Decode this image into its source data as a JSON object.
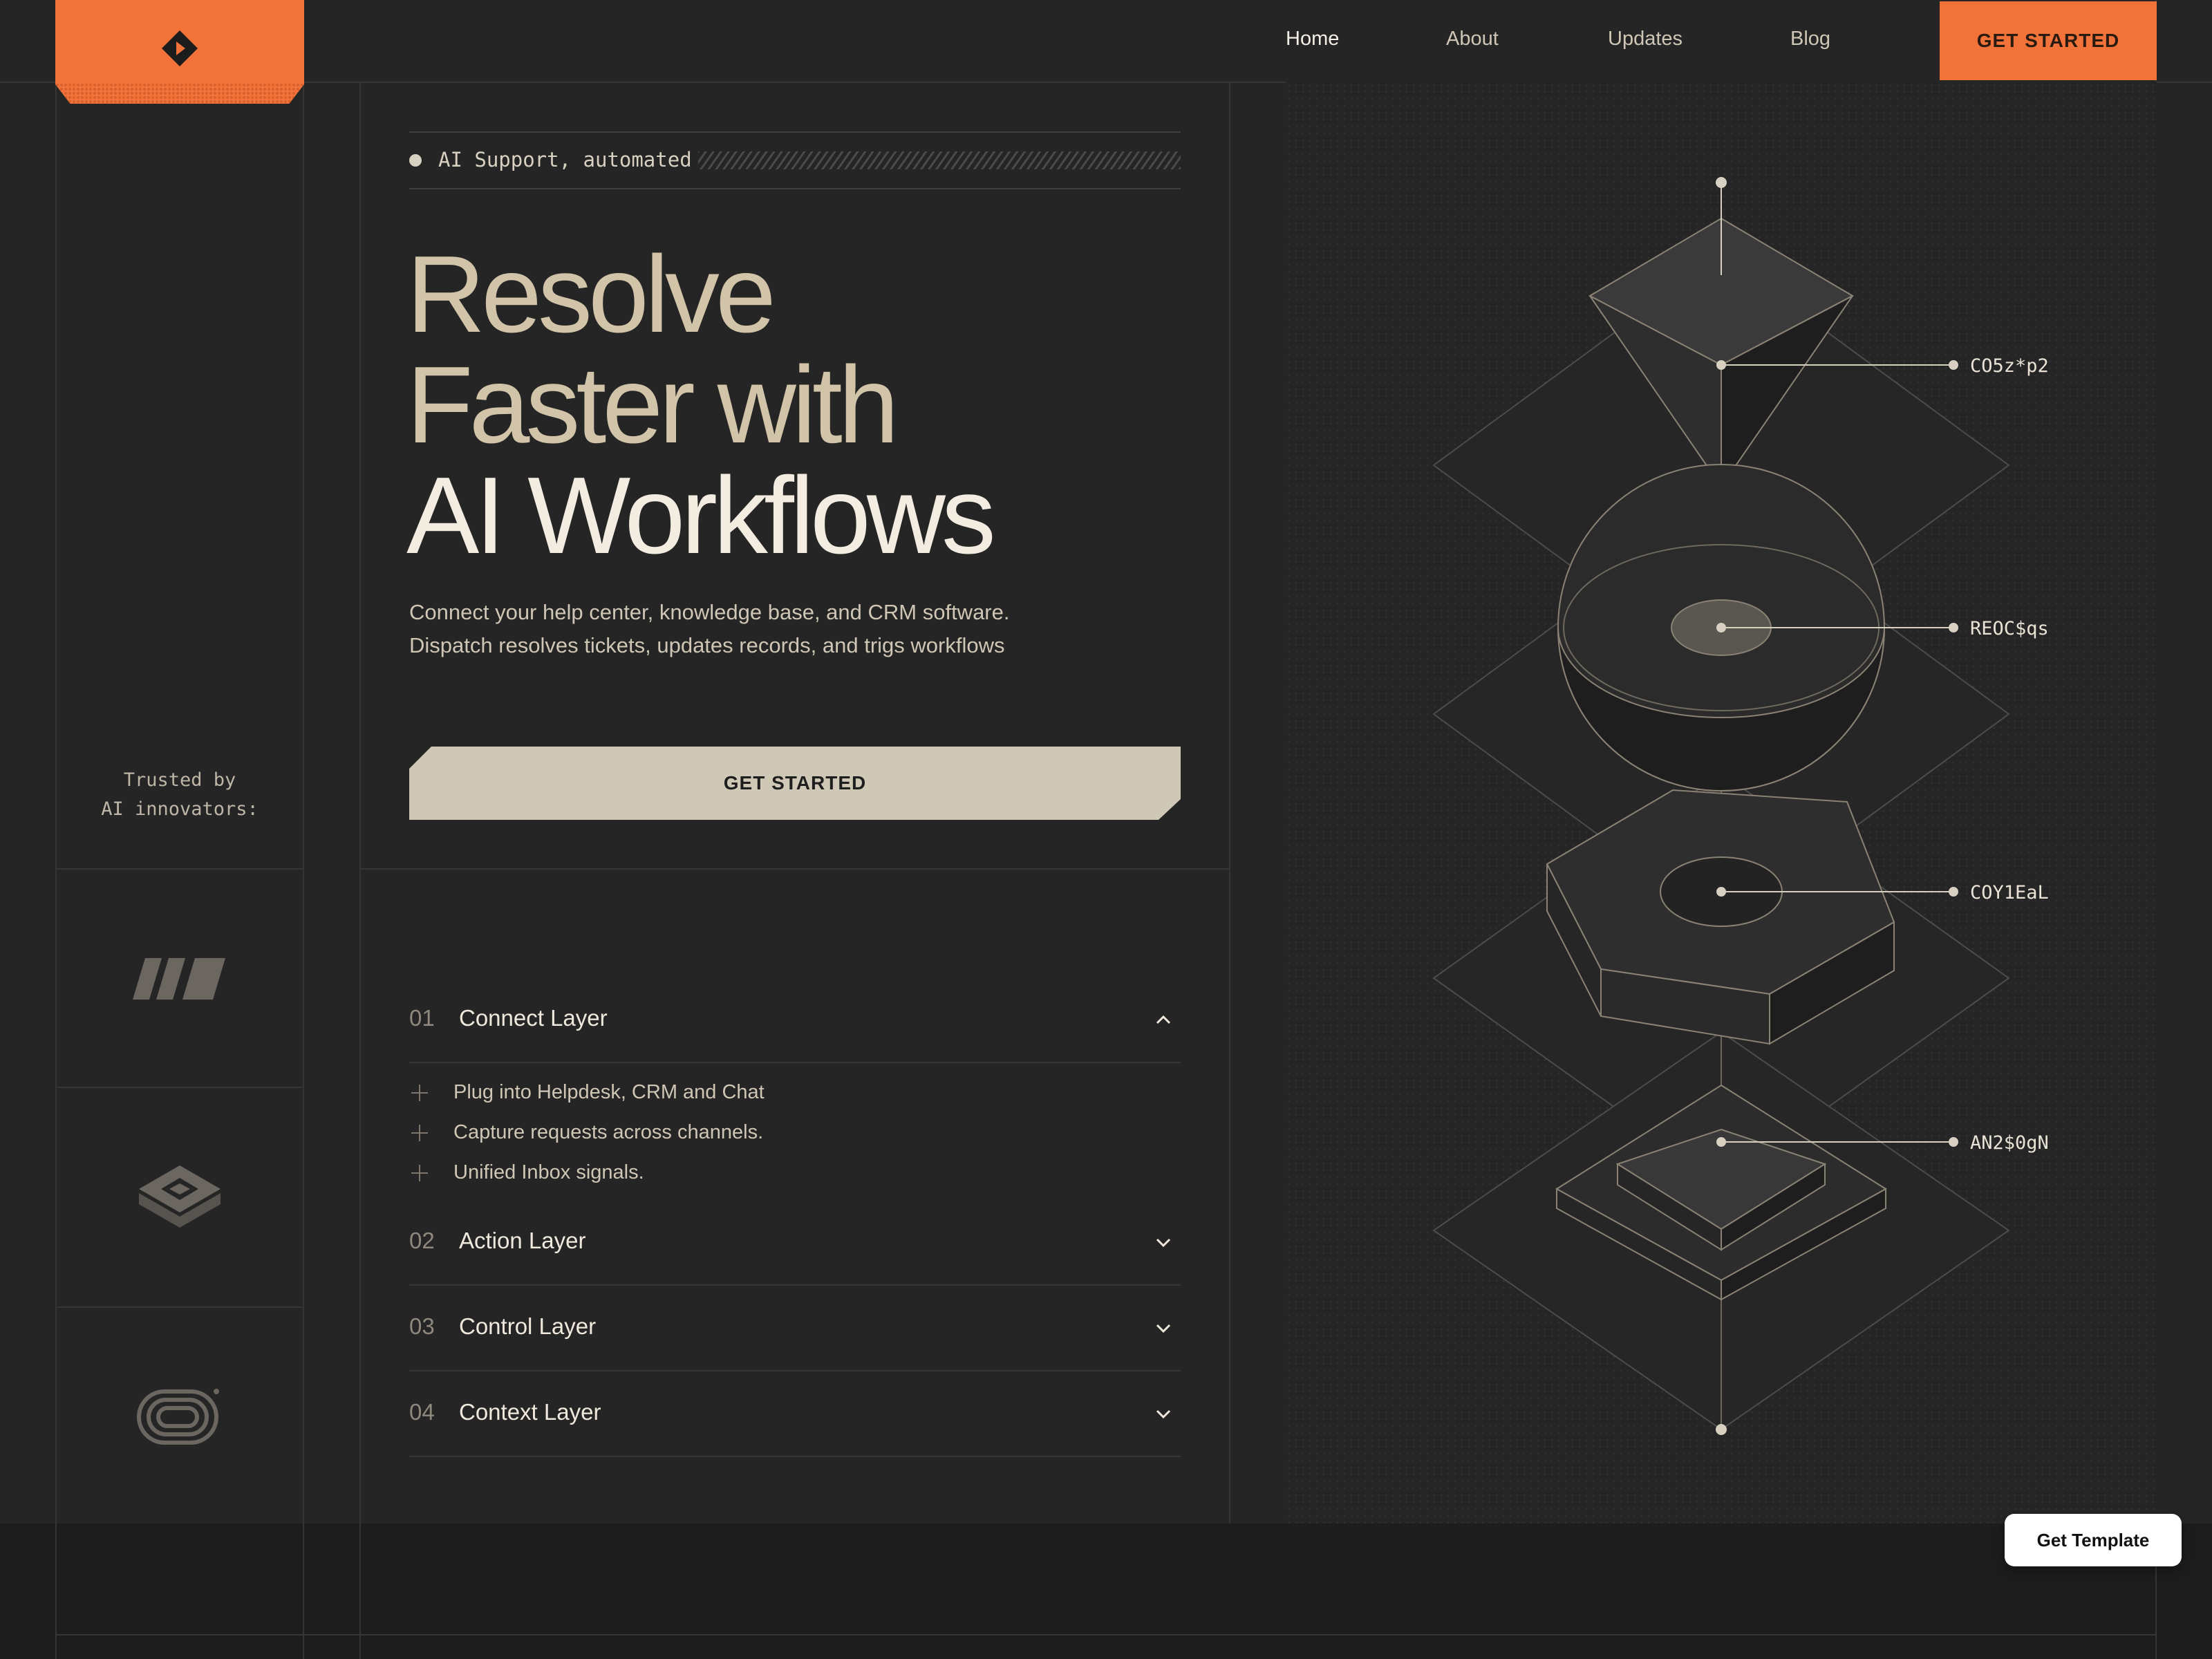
{
  "nav": {
    "links": [
      "Home",
      "About",
      "Updates",
      "Blog"
    ],
    "cta": "GET STARTED"
  },
  "left": {
    "trusted_line1": "Trusted by",
    "trusted_line2": "AI innovators:"
  },
  "hero": {
    "tagline": "AI Support, automated",
    "headline": [
      "Resolve",
      "Faster with",
      "AI Workflows"
    ],
    "subtitle_line1": "Connect your help center, knowledge base, and CRM software.",
    "subtitle_line2": "Dispatch resolves tickets, updates records, and trigs workflows",
    "cta": "GET STARTED"
  },
  "accordion": [
    {
      "num": "01",
      "title": "Connect Layer",
      "expanded": true,
      "items": [
        "Plug into Helpdesk, CRM and Chat",
        "Capture requests across channels.",
        "Unified Inbox signals."
      ]
    },
    {
      "num": "02",
      "title": "Action Layer",
      "expanded": false
    },
    {
      "num": "03",
      "title": "Control Layer",
      "expanded": false
    },
    {
      "num": "04",
      "title": "Context Layer",
      "expanded": false
    }
  ],
  "illustration": {
    "labels": [
      "CO5z*p2",
      "REOC$qs",
      "COY1EaL",
      "AN2$0gN"
    ]
  },
  "floating": {
    "get_template": "Get Template"
  },
  "colors": {
    "accent": "#f2733a",
    "background": "#252525",
    "cta_light": "#d0c8b6",
    "headline_tan": "#d2c4a8"
  }
}
